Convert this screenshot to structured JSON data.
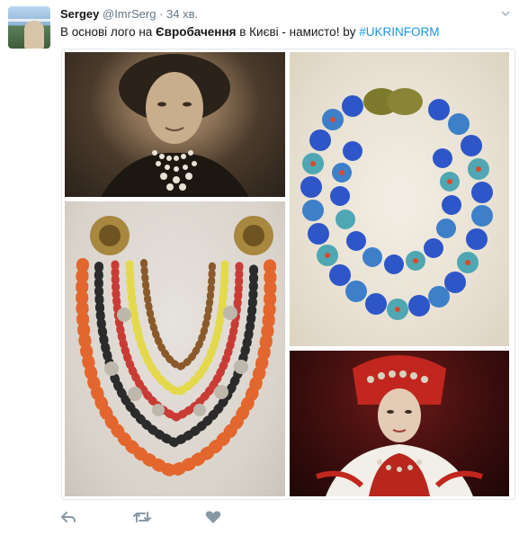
{
  "tweet": {
    "author_name": "Sergey",
    "author_handle": "@ImrSerg",
    "separator": "·",
    "time": "34 хв.",
    "text_before": "В основі лого на ",
    "text_bold": "Євробачення",
    "text_after": " в Києві - намисто!  by ",
    "hashtag": "#UKRINFORM"
  },
  "media": {
    "photos": [
      {
        "name": "woman-portrait-photo",
        "icon": "vintage-portrait"
      },
      {
        "name": "blue-bead-necklace-photo",
        "icon": "blue-beads"
      },
      {
        "name": "coral-necklace-photo",
        "icon": "coral-necklace"
      },
      {
        "name": "woman-traditional-dress-photo",
        "icon": "traditional-dress"
      }
    ]
  },
  "actions": {
    "reply_icon": "reply-icon",
    "retweet_icon": "retweet-icon",
    "like_icon": "heart-icon"
  },
  "colors": {
    "link": "#1b95e0",
    "muted": "#657786",
    "action_icon": "#8899a6"
  }
}
